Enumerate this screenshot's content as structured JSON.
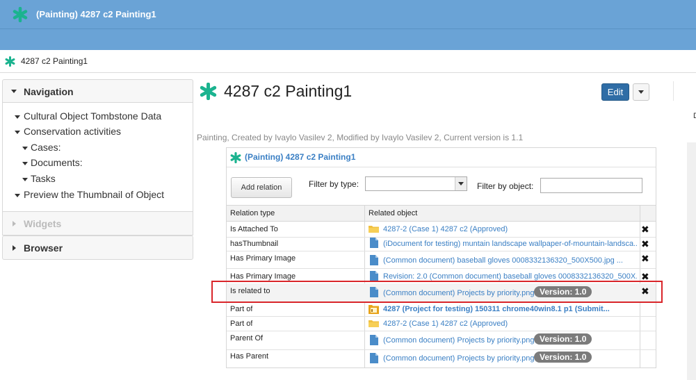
{
  "header": {
    "title": "(Painting) 4287 c2 Painting1"
  },
  "breadcrumb": {
    "label": "4287 c2 Painting1"
  },
  "sidebar": {
    "navigation_title": "Navigation",
    "items": [
      {
        "label": "Cultural Object Tombstone Data"
      },
      {
        "label": "Conservation activities"
      },
      {
        "label": "Cases:"
      },
      {
        "label": "Documents:"
      },
      {
        "label": "Tasks"
      },
      {
        "label": "Preview the Thumbnail of Object"
      }
    ],
    "widgets_title": "Widgets",
    "browser_title": "Browser"
  },
  "page": {
    "title": "4287 c2 Painting1",
    "edit_label": "Edit",
    "meta": "Painting, Created by Ivaylo Vasilev 2, Modified by Ivaylo Vasilev 2, Current version is 1.1",
    "stray_char": "D"
  },
  "relations": {
    "title": "(Painting) 4287 c2 Painting1",
    "add_label": "Add relation",
    "filter_type_label": "Filter by type:",
    "filter_type_value": "",
    "filter_object_label": "Filter by object:",
    "filter_object_value": "",
    "columns": [
      "Relation type",
      "Related object"
    ],
    "rows": [
      {
        "type": "Is Attached To",
        "object": "4287-2 (Case 1) 4287 c2 (Approved)",
        "icon": "folder-icon",
        "badge": "",
        "remove": "✖"
      },
      {
        "type": "hasThumbnail",
        "object": "(iDocument for testing) muntain landscape wallpaper-of-mountain-landsca...",
        "icon": "document-icon",
        "badge": "",
        "remove": "✖"
      },
      {
        "type": "Has Primary Image",
        "object": "(Common document) baseball gloves 0008332136320_500X500.jpg ...",
        "icon": "document-icon",
        "badge": "",
        "remove": "✖"
      },
      {
        "type": "Has Primary Image",
        "object": "Revision: 2.0 (Common document) baseball gloves 0008332136320_500X...",
        "icon": "document-icon",
        "badge": "",
        "remove": "✖"
      },
      {
        "type": "Is related to",
        "object": "(Common document) Projects by priority.png",
        "icon": "document-icon",
        "badge": "Version: 1.0",
        "remove": "✖"
      },
      {
        "type": "Part of",
        "object": "4287 (Project for testing) 150311 chrome40win8.1 p1 (Submit...",
        "icon": "project-icon",
        "badge": "",
        "remove": ""
      },
      {
        "type": "Part of",
        "object": "4287-2 (Case 1) 4287 c2 (Approved)",
        "icon": "folder-icon",
        "badge": "",
        "remove": ""
      },
      {
        "type": "Parent Of",
        "object": "(Common document) Projects by priority.png",
        "icon": "document-icon",
        "badge": "Version: 1.0",
        "remove": ""
      },
      {
        "type": "Has Parent",
        "object": "(Common document) Projects by priority.png",
        "icon": "document-icon",
        "badge": "Version: 1.0",
        "remove": ""
      }
    ]
  },
  "colors": {
    "header": "#6aa3d6",
    "accent": "#1bb38f",
    "link": "#3a7fc4",
    "edit_button": "#2f6da6",
    "highlight": "#d9252a"
  }
}
